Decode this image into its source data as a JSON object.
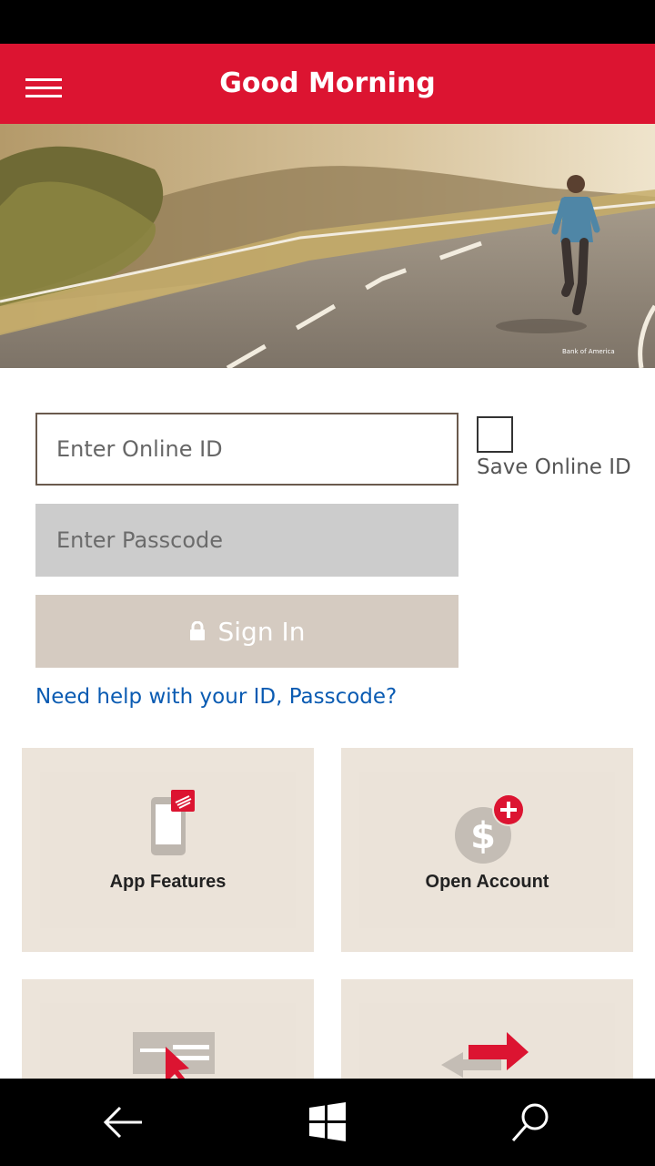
{
  "header": {
    "title": "Good Morning"
  },
  "hero": {
    "watermark": "Bank of America"
  },
  "login": {
    "online_id_placeholder": "Enter Online ID",
    "passcode_placeholder": "Enter Passcode",
    "save_online_id_label": "Save Online ID",
    "save_online_id_checked": false,
    "sign_in_label": "Sign In",
    "help_link": "Need help with your ID, Passcode?"
  },
  "tiles": [
    {
      "label": "App Features",
      "icon": "phone-icon"
    },
    {
      "label": "Open Account",
      "icon": "dollar-plus-icon"
    },
    {
      "label": "",
      "icon": "form-cursor-icon"
    },
    {
      "label": "",
      "icon": "transfer-arrows-icon"
    }
  ],
  "nav": {
    "back": "back-arrow-icon",
    "home": "windows-logo-icon",
    "search": "search-icon"
  },
  "colors": {
    "brand_red": "#dc1431",
    "tile_bg": "#ece4da",
    "link_blue": "#0a5bb2",
    "sign_in_bg": "#d5cbc1",
    "passcode_bg": "#cccccc"
  }
}
